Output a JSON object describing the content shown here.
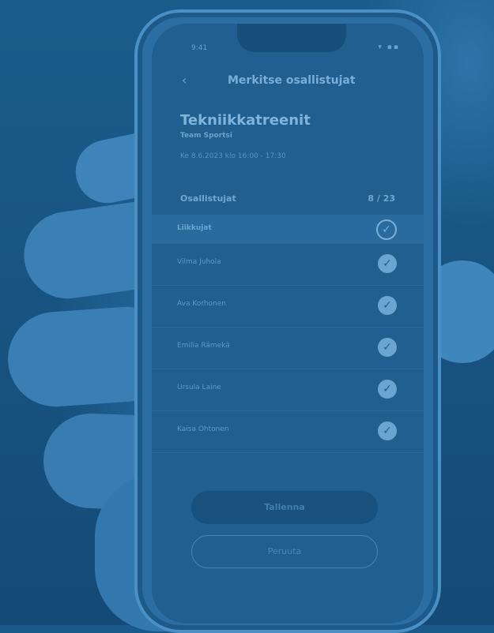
{
  "status": {
    "time": "9:41",
    "icons": "▾ ▪▪"
  },
  "nav": {
    "back_icon": "chevron-left-icon",
    "back_glyph": "‹",
    "title": "Merkitse osallistujat"
  },
  "event": {
    "title": "Tekniikkatreenit",
    "team": "Team Sportsi",
    "datetime": "Ke 8.6.2023 klo 16:00 - 17:30"
  },
  "participants": {
    "label": "Osallistujat",
    "count": "8 / 23",
    "group_label": "Liikkujat",
    "people": [
      {
        "name": "Vilma Juhola",
        "checked": true
      },
      {
        "name": "Ava Korhonen",
        "checked": true
      },
      {
        "name": "Emilia Rämekä",
        "checked": true
      },
      {
        "name": "Ursula Laine",
        "checked": true
      },
      {
        "name": "Kaisa Ohtonen",
        "checked": true
      }
    ]
  },
  "buttons": {
    "save": "Tallenna",
    "cancel": "Peruuta"
  },
  "colors": {
    "overlay": "#1a5a8a",
    "accent": "#6aa4d1"
  }
}
